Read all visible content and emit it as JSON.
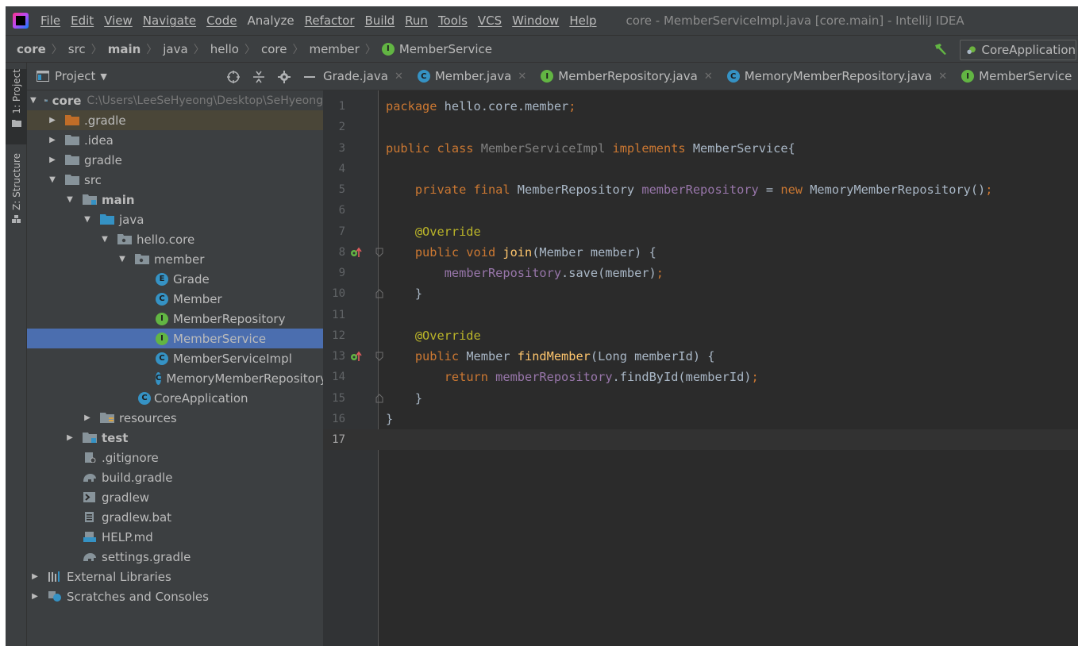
{
  "menu": {
    "items": [
      "File",
      "Edit",
      "View",
      "Navigate",
      "Code",
      "Analyze",
      "Refactor",
      "Build",
      "Run",
      "Tools",
      "VCS",
      "Window",
      "Help"
    ],
    "window_title": "core - MemberServiceImpl.java [core.main] - IntelliJ IDEA"
  },
  "breadcrumb": [
    "core",
    "src",
    "main",
    "java",
    "hello",
    "core",
    "member",
    "MemberService"
  ],
  "run_config": "CoreApplication",
  "toolstrip": {
    "project": "1: Project",
    "structure": "Z: Structure"
  },
  "project": {
    "title": "Project",
    "root_name": "core",
    "root_path": "C:\\Users\\LeeSeHyeong\\Desktop\\SeHyeong",
    "tree": [
      {
        "label": ".gradle"
      },
      {
        "label": ".idea"
      },
      {
        "label": "gradle"
      },
      {
        "label": "src"
      },
      {
        "label": "main"
      },
      {
        "label": "java"
      },
      {
        "label": "hello.core"
      },
      {
        "label": "member"
      },
      {
        "label": "Grade"
      },
      {
        "label": "Member"
      },
      {
        "label": "MemberRepository"
      },
      {
        "label": "MemberService"
      },
      {
        "label": "MemberServiceImpl"
      },
      {
        "label": "MemoryMemberRepository"
      },
      {
        "label": "CoreApplication"
      },
      {
        "label": "resources"
      },
      {
        "label": "test"
      },
      {
        "label": ".gitignore"
      },
      {
        "label": "build.gradle"
      },
      {
        "label": "gradlew"
      },
      {
        "label": "gradlew.bat"
      },
      {
        "label": "HELP.md"
      },
      {
        "label": "settings.gradle"
      },
      {
        "label": "External Libraries"
      },
      {
        "label": "Scratches and Consoles"
      }
    ]
  },
  "tabs": [
    "Grade.java",
    "Member.java",
    "MemberRepository.java",
    "MemoryMemberRepository.java",
    "MemberService.java"
  ],
  "editor": {
    "line_numbers": [
      "1",
      "2",
      "3",
      "4",
      "5",
      "6",
      "7",
      "8",
      "9",
      "10",
      "11",
      "12",
      "13",
      "14",
      "15",
      "16",
      "17"
    ],
    "current_line": 17
  },
  "colors": {
    "background": "#2b2b2b",
    "panel": "#3c3f41",
    "selection": "#4b6eaf",
    "keyword": "#cc7832",
    "annotation": "#bbb529",
    "field": "#9876aa",
    "method": "#ffc66d",
    "interface_badge": "#62b543",
    "class_badge": "#3592c4"
  }
}
